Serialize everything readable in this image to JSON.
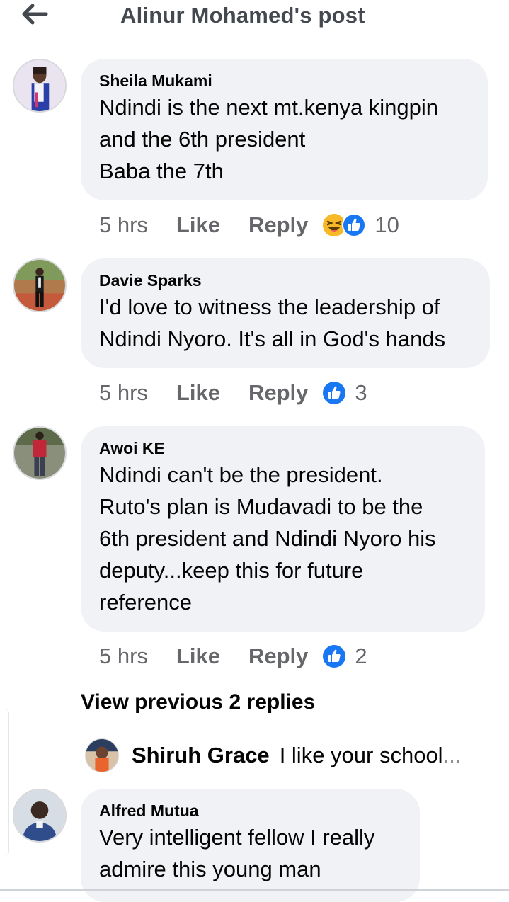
{
  "header": {
    "title": "Alinur Mohamed's post",
    "back_icon": "arrow-left-icon"
  },
  "comments": [
    {
      "author": "Sheila Mukami",
      "text": "Ndindi is the next mt.kenya kingpin\nand the 6th president\nBaba the 7th",
      "time": "5 hrs",
      "like_label": "Like",
      "reply_label": "Reply",
      "reactions": [
        "haha-icon",
        "like-icon"
      ],
      "reaction_count": "10"
    },
    {
      "author": "Davie Sparks",
      "text": "I'd love to witness the leadership of\nNdindi Nyoro. It's all in God's hands",
      "time": "5 hrs",
      "like_label": "Like",
      "reply_label": "Reply",
      "reactions": [
        "like-icon"
      ],
      "reaction_count": "3"
    },
    {
      "author": "Awoi KE",
      "text": "Ndindi can't be the president.\nRuto's plan is Mudavadi to be the\n6th president and Ndindi Nyoro his\ndeputy...keep this for future\nreference",
      "time": "5 hrs",
      "like_label": "Like",
      "reply_label": "Reply",
      "reactions": [
        "like-icon"
      ],
      "reaction_count": "2"
    },
    {
      "author": "Alfred Mutua",
      "text": "Very intelligent fellow I really\nadmire this young man"
    }
  ],
  "view_previous": "View previous 2 replies",
  "reply_preview": {
    "author": "Shiruh Grace",
    "snippet": "I like your school",
    "ellipsis": "..."
  },
  "colors": {
    "bubble": "#f0f2f5",
    "meta": "#65676b",
    "like_blue": "#1877f2",
    "haha_yellow": "#f7b928"
  }
}
